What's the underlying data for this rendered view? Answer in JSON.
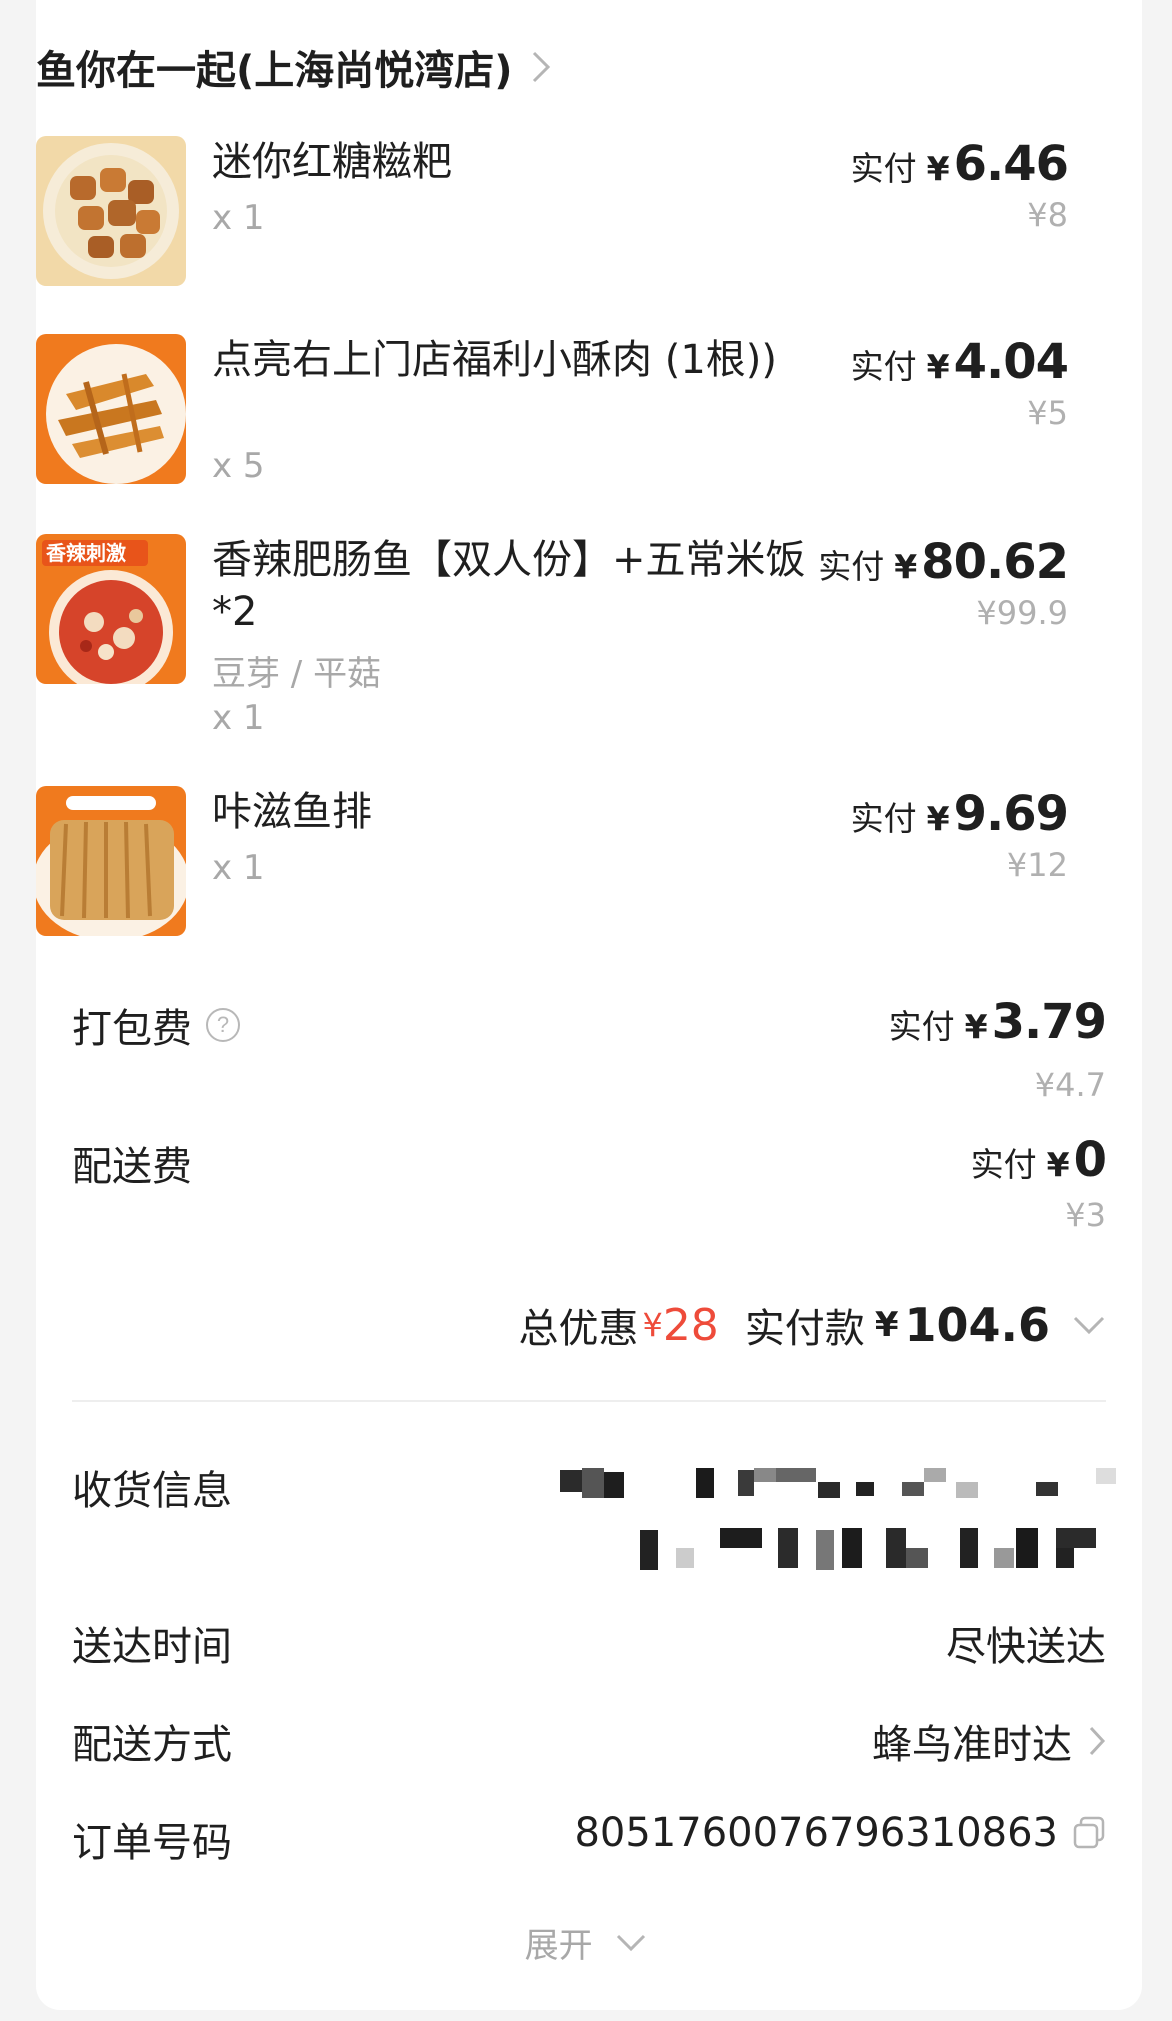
{
  "store": {
    "name": "鱼你在一起(上海尚悦湾店)"
  },
  "items": [
    {
      "name": "迷你红糖糍粑",
      "spec": "",
      "qty": "x 1",
      "paid_label": "实付",
      "currency": "¥",
      "paid": "6.46",
      "original": "¥8",
      "thumb_icon": "brown-sugar-rice-cake-photo"
    },
    {
      "name": "点亮右上门店福利小酥肉 (1根))",
      "spec": "",
      "qty": "x 5",
      "paid_label": "实付",
      "currency": "¥",
      "paid": "4.04",
      "original": "¥5",
      "thumb_icon": "crispy-pork-photo"
    },
    {
      "name": "香辣肥肠鱼【双人份】+五常米饭*2",
      "spec": "豆芽 / 平菇",
      "qty": "x 1",
      "paid_label": "实付",
      "currency": "¥",
      "paid": "80.62",
      "original": "¥99.9",
      "thumb_icon": "spicy-fish-photo",
      "thumb_badge": "香辣刺激"
    },
    {
      "name": "咔滋鱼排",
      "spec": "",
      "qty": "x 1",
      "paid_label": "实付",
      "currency": "¥",
      "paid": "9.69",
      "original": "¥12",
      "thumb_icon": "fish-fillet-photo"
    }
  ],
  "fees": {
    "packing": {
      "label": "打包费",
      "help_icon": "question-circle-icon",
      "paid_label": "实付",
      "currency": "¥",
      "paid": "3.79",
      "original": "¥4.7"
    },
    "delivery": {
      "label": "配送费",
      "paid_label": "实付",
      "currency": "¥",
      "paid": "0",
      "original": "¥3"
    }
  },
  "total": {
    "discount_label": "总优惠",
    "discount_currency": "¥",
    "discount": "28",
    "paid_label": "实付款",
    "currency": "¥",
    "paid": "104.6"
  },
  "info": {
    "address_label": "收货信息",
    "time_label": "送达时间",
    "time_value": "尽快送达",
    "method_label": "配送方式",
    "method_value": "蜂鸟准时达",
    "order_label": "订单号码",
    "order_value": "8051760076796310863"
  },
  "expand_label": "展开",
  "colors": {
    "discount_red": "#ee4b3a",
    "muted": "#a8a8a8",
    "brand_orange": "#f07a1e"
  }
}
